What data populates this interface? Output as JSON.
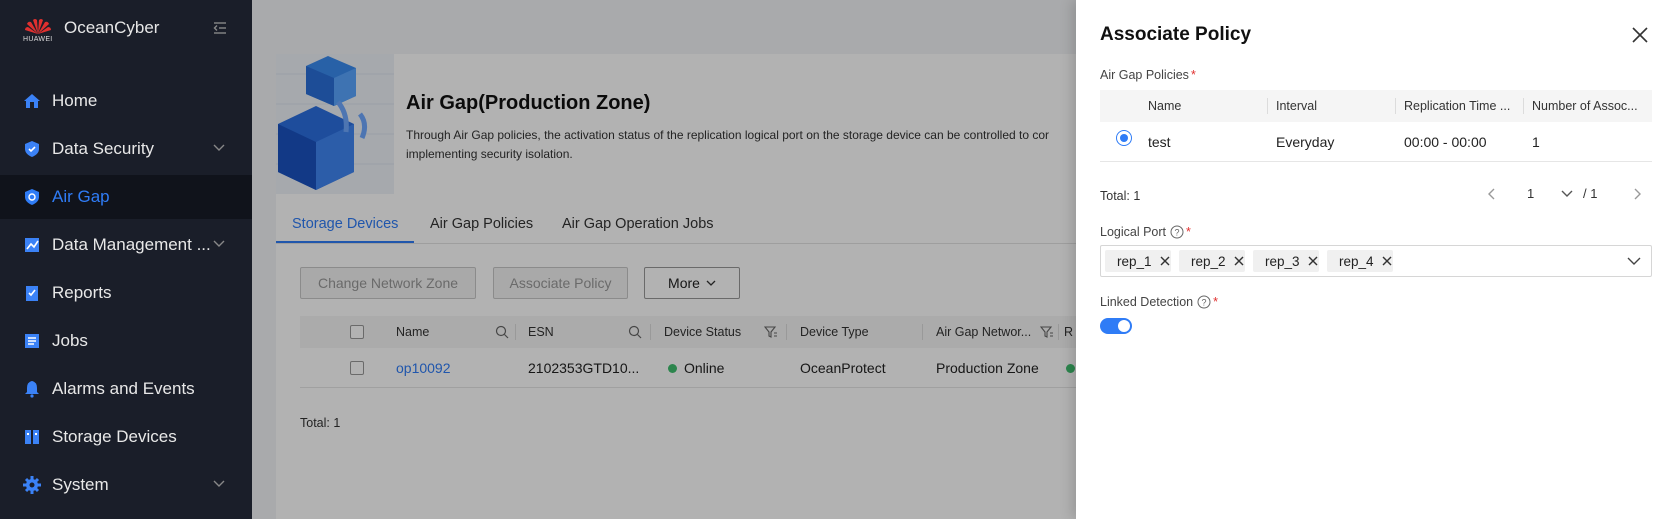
{
  "sidebar": {
    "brand_logo_text": "HUAWEI",
    "app_name": "OceanCyber",
    "items": [
      {
        "label": "Home"
      },
      {
        "label": "Data Security"
      },
      {
        "label": "Air Gap"
      },
      {
        "label": "Data Management ..."
      },
      {
        "label": "Reports"
      },
      {
        "label": "Jobs"
      },
      {
        "label": "Alarms and Events"
      },
      {
        "label": "Storage Devices"
      },
      {
        "label": "System"
      }
    ]
  },
  "main": {
    "hero_title": "Air Gap(Production Zone)",
    "hero_desc": "Through Air Gap policies, the activation status of the replication logical port on the storage device can be controlled to cor implementing security isolation.",
    "tabs": [
      {
        "label": "Storage Devices"
      },
      {
        "label": "Air Gap Policies"
      },
      {
        "label": "Air Gap Operation Jobs"
      }
    ],
    "buttons": {
      "change_zone": "Change Network Zone",
      "associate": "Associate Policy",
      "more": "More"
    },
    "columns": [
      "Name",
      "ESN",
      "Device Status",
      "Device Type",
      "Air Gap Networ...",
      "R"
    ],
    "rows": [
      {
        "name": "op10092",
        "esn": "2102353GTD10...",
        "status": "Online",
        "type": "OceanProtect",
        "zone": "Production Zone"
      }
    ],
    "total": "Total: 1"
  },
  "drawer": {
    "title": "Associate Policy",
    "policies_label": "Air Gap Policies",
    "required_mark": "*",
    "columns": [
      "Name",
      "Interval",
      "Replication Time ...",
      "Number of Assoc..."
    ],
    "rows": [
      {
        "name": "test",
        "interval": "Everyday",
        "time": "00:00 - 00:00",
        "count": "1"
      }
    ],
    "total": "Total: 1",
    "pager": {
      "page": "1",
      "of": "/ 1"
    },
    "logical_port_label": "Logical Port",
    "ports": [
      "rep_1",
      "rep_2",
      "rep_3",
      "rep_4"
    ],
    "linked_detection_label": "Linked Detection",
    "linked_detection_on": true
  },
  "colors": {
    "accent": "#2f7cf6",
    "sidebar_bg": "#1a1e29",
    "online": "#3fbf6f",
    "required": "#e0302f"
  }
}
